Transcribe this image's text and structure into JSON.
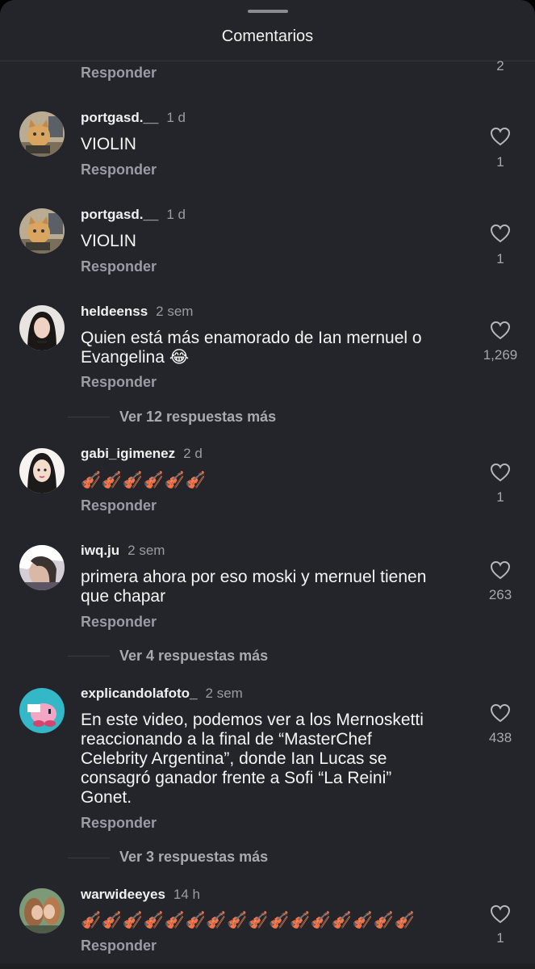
{
  "header": {
    "title": "Comentarios"
  },
  "top_partial": {
    "reply_label": "Responder",
    "likes": "2"
  },
  "comments": [
    {
      "user": "portgasd.__",
      "time": "1 d",
      "text": "VIOLIN",
      "reply": "Responder",
      "likes": "1",
      "avatar": "cat-avatar-icon"
    },
    {
      "user": "portgasd.__",
      "time": "1 d",
      "text": "VIOLIN",
      "reply": "Responder",
      "likes": "1",
      "avatar": "cat-avatar-icon"
    },
    {
      "user": "heldeenss",
      "time": "2 sem",
      "text_lines": [
        "Quien está más enamorado de Ian mernuel o",
        "Evangelina 😂"
      ],
      "reply": "Responder",
      "likes": "1,269",
      "avatar": "girl-avatar-icon",
      "more_replies": "Ver 12 respuestas más"
    },
    {
      "user": "gabi_igimenez",
      "time": "2 d",
      "text": "🎻🎻🎻🎻🎻🎻",
      "reply": "Responder",
      "likes": "1",
      "avatar": "cartoon-girl-avatar-icon"
    },
    {
      "user": "iwq.ju",
      "time": "2 sem",
      "text_lines": [
        "primera ahora por eso moski y mernuel tienen",
        "que chapar"
      ],
      "reply": "Responder",
      "likes": "263",
      "avatar": "selfie-avatar-icon",
      "more_replies": "Ver 4 respuestas más"
    },
    {
      "user": "explicandolafoto_",
      "time": "2 sem",
      "text_lines": [
        "En este video, podemos ver a los Mernosketti",
        "reaccionando a la final de “MasterChef",
        "Celebrity Argentina”, donde Ian Lucas se",
        "consagró ganador frente a Sofi “La Reini”",
        "Gonet."
      ],
      "reply": "Responder",
      "likes": "438",
      "avatar": "kirby-avatar-icon",
      "more_replies": "Ver 3 respuestas más"
    },
    {
      "user": "warwideeyes",
      "time": "14 h",
      "text": "🎻🎻🎻🎻🎻🎻🎻🎻🎻🎻🎻🎻🎻🎻🎻🎻",
      "reply": "Responder",
      "likes": "1",
      "avatar": "couple-avatar-icon"
    }
  ],
  "colors": {
    "sheet_bg": "#24252a",
    "muted": "#9a9ca3",
    "text": "#f4f4f4"
  }
}
